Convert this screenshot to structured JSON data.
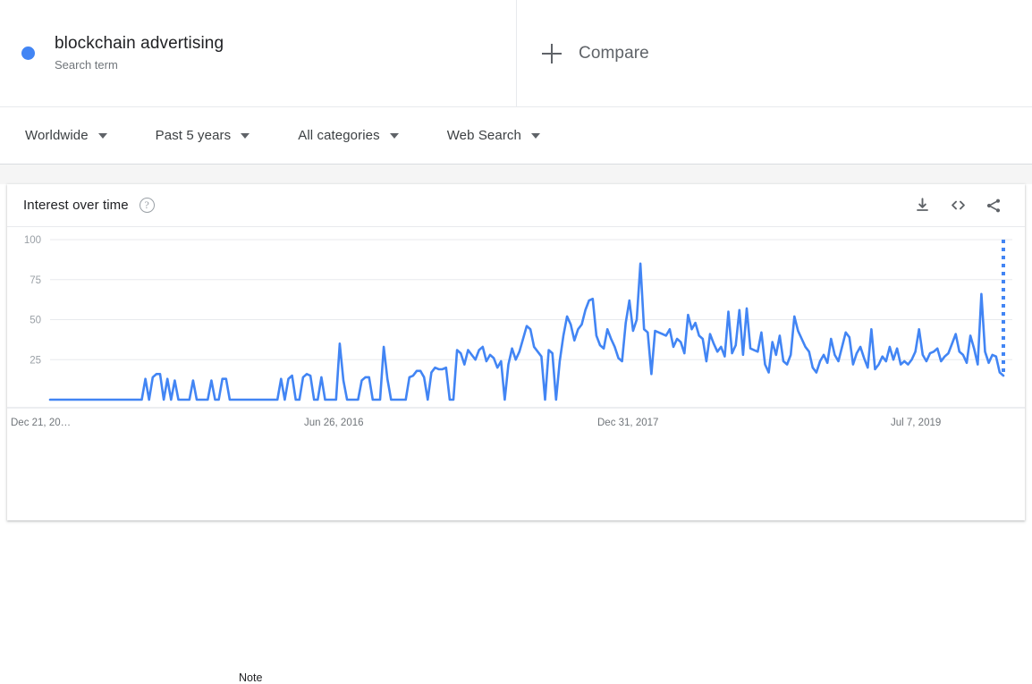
{
  "term": {
    "name": "blockchain advertising",
    "type_label": "Search term",
    "dot_color": "#4285F4"
  },
  "compare": {
    "label": "Compare",
    "icon": "plus-icon"
  },
  "filters": [
    {
      "label": "Worldwide",
      "name": "location"
    },
    {
      "label": "Past 5 years",
      "name": "time-range"
    },
    {
      "label": "All categories",
      "name": "category"
    },
    {
      "label": "Web Search",
      "name": "search-type"
    }
  ],
  "card": {
    "title": "Interest over time",
    "help_icon": "?",
    "actions": [
      {
        "name": "download-icon",
        "label": "Download"
      },
      {
        "name": "embed-icon",
        "label": "Embed"
      },
      {
        "name": "share-icon",
        "label": "Share"
      }
    ]
  },
  "annotation": {
    "note": "Note"
  },
  "chart_data": {
    "type": "line",
    "title": "Interest over time",
    "xlabel": "",
    "ylabel": "",
    "ylim": [
      0,
      100
    ],
    "yticks": [
      25,
      50,
      75,
      100
    ],
    "grid": true,
    "legend": "none",
    "line_color": "#4285F4",
    "partial_data_marker": {
      "style": "dotted-vertical",
      "x_index": 260,
      "color": "#4285F4"
    },
    "xtick_labels": [
      "Dec 21, 20…",
      "Jun 26, 2016",
      "Dec 31, 2017",
      "Jul 7, 2019"
    ],
    "xtick_indices": [
      0,
      80,
      160,
      240
    ],
    "series": [
      {
        "name": "blockchain advertising",
        "values": [
          0,
          0,
          0,
          0,
          0,
          0,
          0,
          0,
          0,
          0,
          0,
          0,
          0,
          0,
          0,
          0,
          0,
          0,
          0,
          0,
          0,
          0,
          0,
          0,
          0,
          0,
          13,
          0,
          14,
          16,
          16,
          0,
          13,
          0,
          12,
          0,
          0,
          0,
          0,
          12,
          0,
          0,
          0,
          0,
          12,
          0,
          0,
          13,
          13,
          0,
          0,
          0,
          0,
          0,
          0,
          0,
          0,
          0,
          0,
          0,
          0,
          0,
          0,
          13,
          0,
          13,
          15,
          0,
          0,
          14,
          16,
          15,
          0,
          0,
          14,
          0,
          0,
          0,
          0,
          35,
          12,
          0,
          0,
          0,
          0,
          12,
          14,
          14,
          0,
          0,
          0,
          33,
          13,
          0,
          0,
          0,
          0,
          0,
          14,
          15,
          18,
          18,
          14,
          0,
          17,
          20,
          19,
          19,
          20,
          0,
          0,
          31,
          29,
          22,
          31,
          28,
          25,
          31,
          33,
          24,
          28,
          26,
          20,
          24,
          0,
          22,
          32,
          25,
          30,
          38,
          46,
          44,
          33,
          30,
          27,
          0,
          31,
          29,
          0,
          24,
          40,
          52,
          47,
          37,
          44,
          47,
          56,
          62,
          63,
          40,
          34,
          32,
          44,
          38,
          33,
          26,
          24,
          48,
          62,
          43,
          50,
          85,
          44,
          42,
          16,
          43,
          42,
          41,
          40,
          44,
          33,
          38,
          36,
          29,
          53,
          44,
          48,
          40,
          38,
          24,
          41,
          35,
          30,
          33,
          27,
          55,
          29,
          34,
          56,
          28,
          57,
          32,
          31,
          30,
          42,
          22,
          17,
          36,
          28,
          40,
          24,
          22,
          28,
          52,
          43,
          38,
          33,
          30,
          20,
          17,
          24,
          28,
          23,
          38,
          28,
          24,
          33,
          42,
          39,
          22,
          29,
          33,
          26,
          20,
          44,
          19,
          22,
          27,
          24,
          33,
          25,
          32,
          22,
          24,
          22,
          25,
          30,
          44,
          28,
          24,
          29,
          30,
          32,
          24,
          27,
          29,
          35,
          41,
          30,
          28,
          23,
          40,
          32,
          22,
          66,
          30,
          23,
          28,
          27,
          17,
          15
        ]
      }
    ]
  }
}
